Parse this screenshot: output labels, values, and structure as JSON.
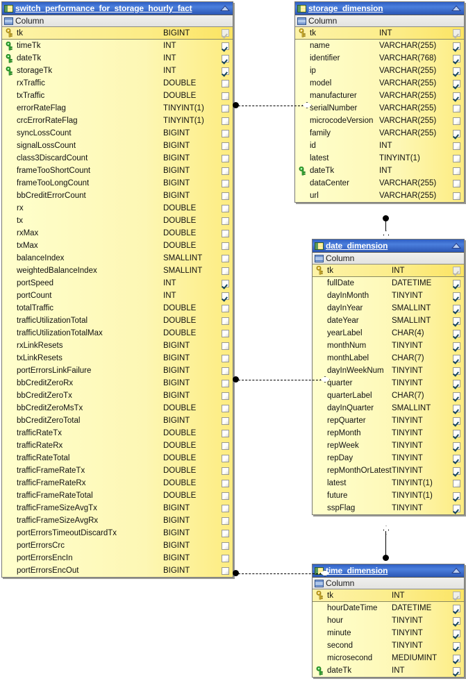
{
  "colors": {
    "title_bar_blue": "#3a6ad0",
    "row_yellow": "#ffffcc",
    "pk_row_yellow": "#fdf0a0",
    "pk_key": "#e8c33a",
    "fk_key": "#3ec23e",
    "check_mark": "#16465e",
    "window_border": "#777772"
  },
  "tables": [
    {
      "name": "switch_performance_for_storage_hourly_fact",
      "title_icon": "table-icon",
      "collapse_icon": "collapse-triangle-icon",
      "section_icon": "columns-group-icon",
      "section_label": "Column",
      "columns": [
        {
          "key": "pk",
          "name": "tk",
          "type": "BIGINT",
          "checked": "dim"
        },
        {
          "key": "fk",
          "name": "timeTk",
          "type": "INT",
          "checked": "on"
        },
        {
          "key": "fk",
          "name": "dateTk",
          "type": "INT",
          "checked": "on"
        },
        {
          "key": "fk",
          "name": "storageTk",
          "type": "INT",
          "checked": "on"
        },
        {
          "key": "none",
          "name": "rxTraffic",
          "type": "DOUBLE",
          "checked": "off"
        },
        {
          "key": "none",
          "name": "txTraffic",
          "type": "DOUBLE",
          "checked": "off"
        },
        {
          "key": "none",
          "name": "errorRateFlag",
          "type": "TINYINT(1)",
          "checked": "off"
        },
        {
          "key": "none",
          "name": "crcErrorRateFlag",
          "type": "TINYINT(1)",
          "checked": "off"
        },
        {
          "key": "none",
          "name": "syncLossCount",
          "type": "BIGINT",
          "checked": "off"
        },
        {
          "key": "none",
          "name": "signalLossCount",
          "type": "BIGINT",
          "checked": "off"
        },
        {
          "key": "none",
          "name": "class3DiscardCount",
          "type": "BIGINT",
          "checked": "off"
        },
        {
          "key": "none",
          "name": "frameTooShortCount",
          "type": "BIGINT",
          "checked": "off"
        },
        {
          "key": "none",
          "name": "frameTooLongCount",
          "type": "BIGINT",
          "checked": "off"
        },
        {
          "key": "none",
          "name": "bbCreditErrorCount",
          "type": "BIGINT",
          "checked": "off"
        },
        {
          "key": "none",
          "name": "rx",
          "type": "DOUBLE",
          "checked": "off"
        },
        {
          "key": "none",
          "name": "tx",
          "type": "DOUBLE",
          "checked": "off"
        },
        {
          "key": "none",
          "name": "rxMax",
          "type": "DOUBLE",
          "checked": "off"
        },
        {
          "key": "none",
          "name": "txMax",
          "type": "DOUBLE",
          "checked": "off"
        },
        {
          "key": "none",
          "name": "balanceIndex",
          "type": "SMALLINT",
          "checked": "off"
        },
        {
          "key": "none",
          "name": "weightedBalanceIndex",
          "type": "SMALLINT",
          "checked": "off"
        },
        {
          "key": "none",
          "name": "portSpeed",
          "type": "INT",
          "checked": "on"
        },
        {
          "key": "none",
          "name": "portCount",
          "type": "INT",
          "checked": "on"
        },
        {
          "key": "none",
          "name": "totalTraffic",
          "type": "DOUBLE",
          "checked": "off"
        },
        {
          "key": "none",
          "name": "trafficUtilizationTotal",
          "type": "DOUBLE",
          "checked": "off"
        },
        {
          "key": "none",
          "name": "trafficUtilizationTotalMax",
          "type": "DOUBLE",
          "checked": "off"
        },
        {
          "key": "none",
          "name": "rxLinkResets",
          "type": "BIGINT",
          "checked": "off"
        },
        {
          "key": "none",
          "name": "txLinkResets",
          "type": "BIGINT",
          "checked": "off"
        },
        {
          "key": "none",
          "name": "portErrorsLinkFailure",
          "type": "BIGINT",
          "checked": "off"
        },
        {
          "key": "none",
          "name": "bbCreditZeroRx",
          "type": "BIGINT",
          "checked": "off"
        },
        {
          "key": "none",
          "name": "bbCreditZeroTx",
          "type": "BIGINT",
          "checked": "off"
        },
        {
          "key": "none",
          "name": "bbCreditZeroMsTx",
          "type": "DOUBLE",
          "checked": "off"
        },
        {
          "key": "none",
          "name": "bbCreditZeroTotal",
          "type": "BIGINT",
          "checked": "off"
        },
        {
          "key": "none",
          "name": "trafficRateTx",
          "type": "DOUBLE",
          "checked": "off"
        },
        {
          "key": "none",
          "name": "trafficRateRx",
          "type": "DOUBLE",
          "checked": "off"
        },
        {
          "key": "none",
          "name": "trafficRateTotal",
          "type": "DOUBLE",
          "checked": "off"
        },
        {
          "key": "none",
          "name": "trafficFrameRateTx",
          "type": "DOUBLE",
          "checked": "off"
        },
        {
          "key": "none",
          "name": "trafficFrameRateRx",
          "type": "DOUBLE",
          "checked": "off"
        },
        {
          "key": "none",
          "name": "trafficFrameRateTotal",
          "type": "DOUBLE",
          "checked": "off"
        },
        {
          "key": "none",
          "name": "trafficFrameSizeAvgTx",
          "type": "BIGINT",
          "checked": "off"
        },
        {
          "key": "none",
          "name": "trafficFrameSizeAvgRx",
          "type": "BIGINT",
          "checked": "off"
        },
        {
          "key": "none",
          "name": "portErrorsTimeoutDiscardTx",
          "type": "BIGINT",
          "checked": "off"
        },
        {
          "key": "none",
          "name": "portErrorsCrc",
          "type": "BIGINT",
          "checked": "off"
        },
        {
          "key": "none",
          "name": "portErrorsEncIn",
          "type": "BIGINT",
          "checked": "off"
        },
        {
          "key": "none",
          "name": "portErrorsEncOut",
          "type": "BIGINT",
          "checked": "off"
        }
      ]
    },
    {
      "name": "storage_dimension",
      "title_icon": "table-icon",
      "collapse_icon": "collapse-triangle-icon",
      "section_icon": "columns-group-icon",
      "section_label": "Column",
      "columns": [
        {
          "key": "pk",
          "name": "tk",
          "type": "INT",
          "checked": "dim"
        },
        {
          "key": "none",
          "name": "name",
          "type": "VARCHAR(255)",
          "checked": "on"
        },
        {
          "key": "none",
          "name": "identifier",
          "type": "VARCHAR(768)",
          "checked": "on"
        },
        {
          "key": "none",
          "name": "ip",
          "type": "VARCHAR(255)",
          "checked": "on"
        },
        {
          "key": "none",
          "name": "model",
          "type": "VARCHAR(255)",
          "checked": "on"
        },
        {
          "key": "none",
          "name": "manufacturer",
          "type": "VARCHAR(255)",
          "checked": "on"
        },
        {
          "key": "none",
          "name": "serialNumber",
          "type": "VARCHAR(255)",
          "checked": "off"
        },
        {
          "key": "none",
          "name": "microcodeVersion",
          "type": "VARCHAR(255)",
          "checked": "off"
        },
        {
          "key": "none",
          "name": "family",
          "type": "VARCHAR(255)",
          "checked": "on"
        },
        {
          "key": "none",
          "name": "id",
          "type": "INT",
          "checked": "off"
        },
        {
          "key": "none",
          "name": "latest",
          "type": "TINYINT(1)",
          "checked": "off"
        },
        {
          "key": "fk",
          "name": "dateTk",
          "type": "INT",
          "checked": "off"
        },
        {
          "key": "none",
          "name": "dataCenter",
          "type": "VARCHAR(255)",
          "checked": "off"
        },
        {
          "key": "none",
          "name": "url",
          "type": "VARCHAR(255)",
          "checked": "off"
        }
      ]
    },
    {
      "name": "date_dimension",
      "title_icon": "table-icon",
      "collapse_icon": "collapse-triangle-icon",
      "section_icon": "columns-group-icon",
      "section_label": "Column",
      "columns": [
        {
          "key": "pk",
          "name": "tk",
          "type": "INT",
          "checked": "dim"
        },
        {
          "key": "none",
          "name": "fullDate",
          "type": "DATETIME",
          "checked": "on"
        },
        {
          "key": "none",
          "name": "dayInMonth",
          "type": "TINYINT",
          "checked": "on"
        },
        {
          "key": "none",
          "name": "dayInYear",
          "type": "SMALLINT",
          "checked": "on"
        },
        {
          "key": "none",
          "name": "dateYear",
          "type": "SMALLINT",
          "checked": "on"
        },
        {
          "key": "none",
          "name": "yearLabel",
          "type": "CHAR(4)",
          "checked": "on"
        },
        {
          "key": "none",
          "name": "monthNum",
          "type": "TINYINT",
          "checked": "on"
        },
        {
          "key": "none",
          "name": "monthLabel",
          "type": "CHAR(7)",
          "checked": "on"
        },
        {
          "key": "none",
          "name": "dayInWeekNum",
          "type": "TINYINT",
          "checked": "on"
        },
        {
          "key": "none",
          "name": "quarter",
          "type": "TINYINT",
          "checked": "on"
        },
        {
          "key": "none",
          "name": "quarterLabel",
          "type": "CHAR(7)",
          "checked": "on"
        },
        {
          "key": "none",
          "name": "dayInQuarter",
          "type": "SMALLINT",
          "checked": "on"
        },
        {
          "key": "none",
          "name": "repQuarter",
          "type": "TINYINT",
          "checked": "on"
        },
        {
          "key": "none",
          "name": "repMonth",
          "type": "TINYINT",
          "checked": "on"
        },
        {
          "key": "none",
          "name": "repWeek",
          "type": "TINYINT",
          "checked": "on"
        },
        {
          "key": "none",
          "name": "repDay",
          "type": "TINYINT",
          "checked": "on"
        },
        {
          "key": "none",
          "name": "repMonthOrLatest",
          "type": "TINYINT",
          "checked": "on"
        },
        {
          "key": "none",
          "name": "latest",
          "type": "TINYINT(1)",
          "checked": "off"
        },
        {
          "key": "none",
          "name": "future",
          "type": "TINYINT(1)",
          "checked": "on"
        },
        {
          "key": "none",
          "name": "sspFlag",
          "type": "TINYINT",
          "checked": "on"
        }
      ]
    },
    {
      "name": "time_dimension",
      "title_icon": "table-icon",
      "collapse_icon": "collapse-triangle-icon",
      "section_icon": "columns-group-icon",
      "section_label": "Column",
      "columns": [
        {
          "key": "pk",
          "name": "tk",
          "type": "INT",
          "checked": "dim"
        },
        {
          "key": "none",
          "name": "hourDateTime",
          "type": "DATETIME",
          "checked": "on"
        },
        {
          "key": "none",
          "name": "hour",
          "type": "TINYINT",
          "checked": "on"
        },
        {
          "key": "none",
          "name": "minute",
          "type": "TINYINT",
          "checked": "on"
        },
        {
          "key": "none",
          "name": "second",
          "type": "TINYINT",
          "checked": "on"
        },
        {
          "key": "none",
          "name": "microsecond",
          "type": "MEDIUMINT",
          "checked": "on"
        },
        {
          "key": "fk",
          "name": "dateTk",
          "type": "INT",
          "checked": "on"
        }
      ]
    }
  ],
  "relationships": [
    {
      "from": "switch_performance_for_storage_hourly_fact",
      "to": "storage_dimension",
      "style": "dashed",
      "from_marker": "filled-circle",
      "to_marker": "open-diamond",
      "orientation": "horizontal"
    },
    {
      "from": "switch_performance_for_storage_hourly_fact",
      "to": "date_dimension",
      "style": "dashed",
      "from_marker": "filled-circle",
      "to_marker": "open-diamond",
      "orientation": "horizontal"
    },
    {
      "from": "switch_performance_for_storage_hourly_fact",
      "to": "time_dimension",
      "style": "dashed",
      "from_marker": "filled-circle",
      "to_marker": "open-diamond",
      "orientation": "horizontal"
    },
    {
      "from": "storage_dimension",
      "to": "date_dimension",
      "style": "solid",
      "from_marker": "filled-circle",
      "to_marker": "open-diamond",
      "orientation": "vertical"
    },
    {
      "from": "time_dimension",
      "to": "date_dimension",
      "style": "solid",
      "from_marker": "filled-circle",
      "to_marker": "open-diamond",
      "orientation": "vertical"
    }
  ]
}
